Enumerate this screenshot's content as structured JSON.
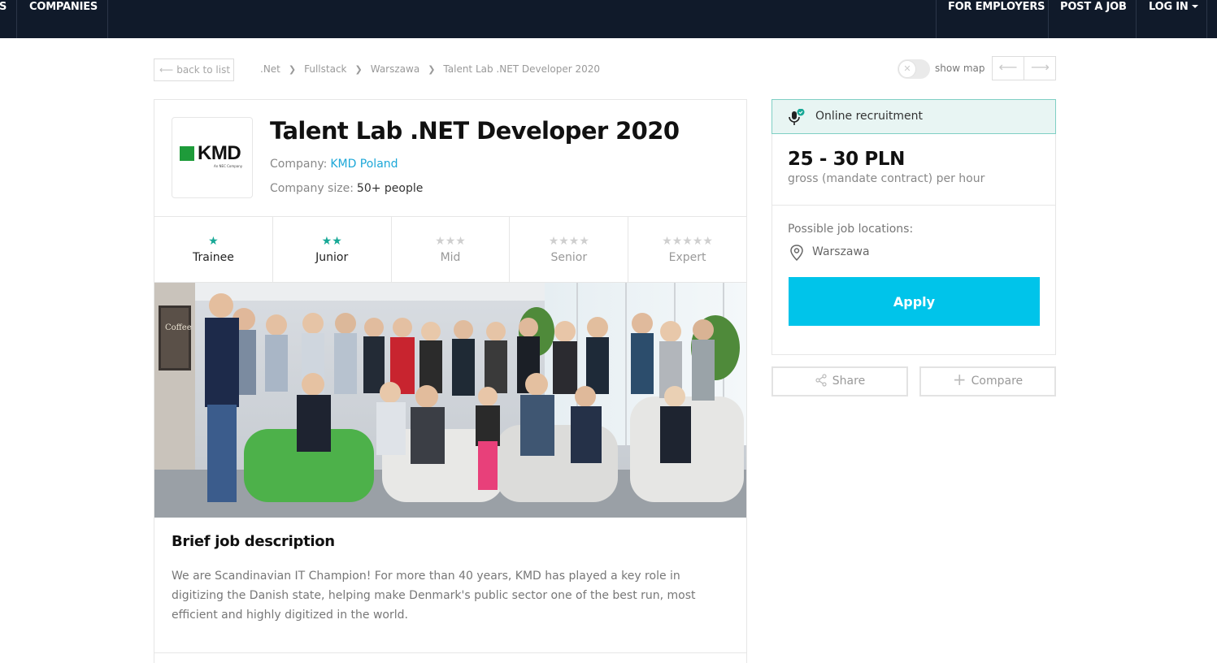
{
  "nav": {
    "left_partial": "S",
    "companies": "COMPANIES",
    "for_employers": "FOR EMPLOYERS",
    "post_a_job": "POST A JOB",
    "log_in": "LOG IN"
  },
  "breadcrumb": {
    "back": "back to list",
    "items": [
      ".Net",
      "Fullstack",
      "Warszawa",
      "Talent Lab .NET Developer 2020"
    ],
    "show_map": "show map"
  },
  "job": {
    "title": "Talent Lab .NET Developer 2020",
    "company_label": "Company:",
    "company": "KMD Poland",
    "size_label": "Company size:",
    "size": "50+ people",
    "logo_text": "KMD",
    "logo_sub": "An NEC Company"
  },
  "levels": [
    {
      "label": "Trainee",
      "stars": 1,
      "active": true
    },
    {
      "label": "Junior",
      "stars": 2,
      "active": true
    },
    {
      "label": "Mid",
      "stars": 3,
      "active": false
    },
    {
      "label": "Senior",
      "stars": 4,
      "active": false
    },
    {
      "label": "Expert",
      "stars": 5,
      "active": false
    }
  ],
  "description": {
    "heading": "Brief job description",
    "text": "We are Scandinavian IT Champion! For more than 40 years, KMD has played a key role in digitizing the Danish state, helping make Denmark's public sector one of the best run, most efficient and highly digitized in the world."
  },
  "side": {
    "online": "Online recruitment",
    "salary": "25 - 30 PLN",
    "salary_note": "gross (mandate contract) per hour",
    "locations_label": "Possible job locations:",
    "location": "Warszawa",
    "apply": "Apply",
    "share": "Share",
    "compare": "Compare"
  },
  "colors": {
    "nav_bg": "#101a2a",
    "accent": "#00c4ea",
    "star_on": "#17a896",
    "link": "#1ca7d8"
  }
}
